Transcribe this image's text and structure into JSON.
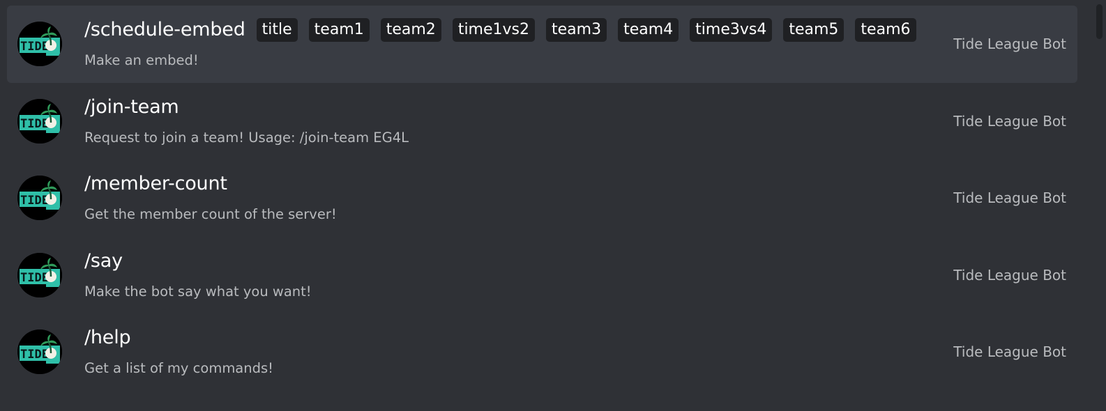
{
  "commands": [
    {
      "name": "/schedule-embed",
      "options": [
        "title",
        "team1",
        "team2",
        "time1vs2",
        "team3",
        "team4",
        "time3vs4",
        "team5",
        "team6"
      ],
      "description": "Make an embed!",
      "source": "Tide League Bot",
      "selected": true
    },
    {
      "name": "/join-team",
      "options": [],
      "description": "Request to join a team! Usage: /join-team EG4L",
      "source": "Tide League Bot",
      "selected": false
    },
    {
      "name": "/member-count",
      "options": [],
      "description": "Get the member count of the server!",
      "source": "Tide League Bot",
      "selected": false
    },
    {
      "name": "/say",
      "options": [],
      "description": "Make the bot say what you want!",
      "source": "Tide League Bot",
      "selected": false
    },
    {
      "name": "/help",
      "options": [],
      "description": "Get a list of my commands!",
      "source": "Tide League Bot",
      "selected": false
    }
  ],
  "avatar": {
    "logo_text": "TIDE",
    "icon": "palm-tree-icon",
    "colors": {
      "bg": "#000000",
      "band": "#2fbfa8",
      "text": "#0a1a1a"
    }
  },
  "colors": {
    "background": "#2f3136",
    "selected_row": "#393c43",
    "option_chip": "#1f2023"
  }
}
